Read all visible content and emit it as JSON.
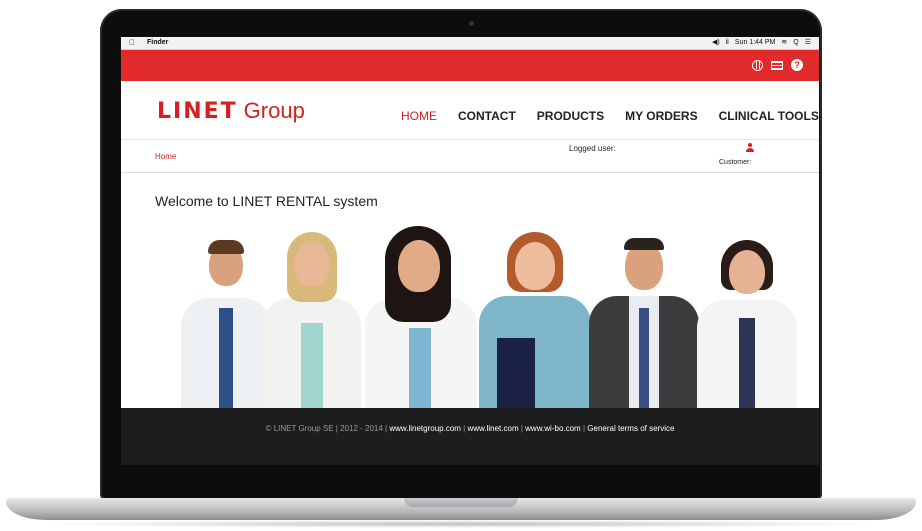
{
  "menubar": {
    "apple_symbol": "",
    "app_name": "Finder",
    "status_items": [
      "◀)",
      "ⅱ",
      "Sun 1:44 PM",
      "≋",
      "Q",
      "☰"
    ]
  },
  "topbar": {
    "icons": [
      "globe-icon",
      "language-flag-icon",
      "help-icon"
    ],
    "help_symbol": "?"
  },
  "header": {
    "logo_brand": "LINET",
    "logo_suffix": "Group",
    "nav": [
      "HOME",
      "CONTACT",
      "PRODUCTS",
      "MY ORDERS",
      "CLINICAL TOOLS"
    ],
    "active_nav": "HOME"
  },
  "subbar": {
    "breadcrumb": "Home",
    "logged_user_label": "Logged user:",
    "customer_label": "Customer:"
  },
  "main": {
    "welcome_title": "Welcome to LINET RENTAL system"
  },
  "footer": {
    "copyright": "© LINET Group SE | 2012 - 2014 |",
    "links": [
      "www.linetgroup.com",
      "www.linet.com",
      "www.wi-bo.com",
      "General terms of service"
    ],
    "separator": "|"
  },
  "colors": {
    "brand_red": "#e12b2b",
    "footer_bg": "#1d1d1d"
  }
}
